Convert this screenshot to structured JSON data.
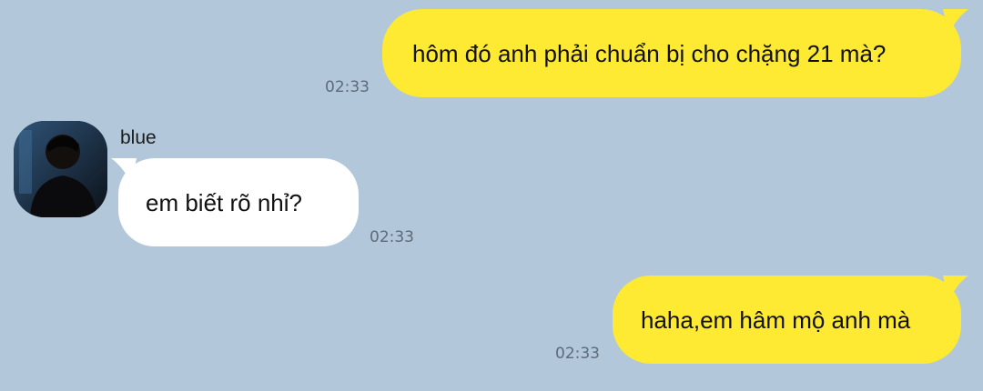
{
  "messages": [
    {
      "side": "outgoing",
      "text": "hôm đó anh phải chuẩn bị cho chặng 21 mà?",
      "time": "02:33"
    },
    {
      "side": "incoming",
      "sender": "blue",
      "text": "em biết rõ nhỉ?",
      "time": "02:33"
    },
    {
      "side": "outgoing",
      "text": "haha,em hâm mộ anh mà",
      "time": "02:33"
    }
  ],
  "colors": {
    "background": "#b2c7da",
    "outgoing_bubble": "#fee933",
    "incoming_bubble": "#ffffff",
    "timestamp": "#5e6b78"
  },
  "icons": {
    "avatar": "profile-photo-silhouette"
  }
}
